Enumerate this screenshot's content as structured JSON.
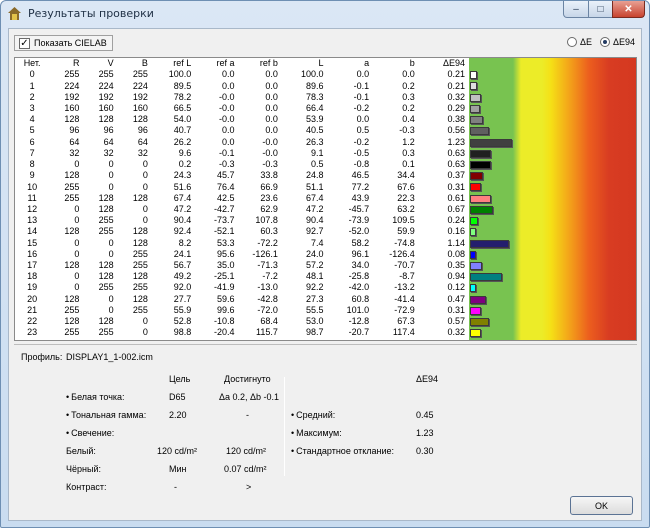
{
  "window": {
    "title": "Результаты проверки",
    "min_icon": "minimize-icon",
    "max_icon": "maximize-icon",
    "close_icon": "close-icon"
  },
  "options": {
    "show_cielab_label": "Показать CIELAB",
    "show_cielab_checked": true,
    "radio_de": "ΔE",
    "radio_de94": "ΔE94",
    "selected": "ΔE94"
  },
  "table": {
    "headers": [
      "Нет.",
      "R",
      "V",
      "B",
      "ref L",
      "ref a",
      "ref b",
      "L",
      "a",
      "b",
      "ΔE94"
    ],
    "rows": [
      {
        "n": "0",
        "r": "255",
        "g": "255",
        "b": "255",
        "refL": "100.0",
        "refa": "0.0",
        "refb": "0.0",
        "L": "100.0",
        "a": "0.0",
        "bb": "0.0",
        "de": "0.21",
        "color": "#ffffff"
      },
      {
        "n": "1",
        "r": "224",
        "g": "224",
        "b": "224",
        "refL": "89.5",
        "refa": "0.0",
        "refb": "0.0",
        "L": "89.6",
        "a": "-0.1",
        "bb": "0.2",
        "de": "0.21",
        "color": "#e0e0e0"
      },
      {
        "n": "2",
        "r": "192",
        "g": "192",
        "b": "192",
        "refL": "78.2",
        "refa": "-0.0",
        "refb": "0.0",
        "L": "78.3",
        "a": "-0.1",
        "bb": "0.3",
        "de": "0.32",
        "color": "#c0c0c0"
      },
      {
        "n": "3",
        "r": "160",
        "g": "160",
        "b": "160",
        "refL": "66.5",
        "refa": "-0.0",
        "refb": "0.0",
        "L": "66.4",
        "a": "-0.2",
        "bb": "0.2",
        "de": "0.29",
        "color": "#a0a0a0"
      },
      {
        "n": "4",
        "r": "128",
        "g": "128",
        "b": "128",
        "refL": "54.0",
        "refa": "-0.0",
        "refb": "0.0",
        "L": "53.9",
        "a": "0.0",
        "bb": "0.4",
        "de": "0.38",
        "color": "#808080"
      },
      {
        "n": "5",
        "r": "96",
        "g": "96",
        "b": "96",
        "refL": "40.7",
        "refa": "0.0",
        "refb": "0.0",
        "L": "40.5",
        "a": "0.5",
        "bb": "-0.3",
        "de": "0.56",
        "color": "#606060"
      },
      {
        "n": "6",
        "r": "64",
        "g": "64",
        "b": "64",
        "refL": "26.2",
        "refa": "0.0",
        "refb": "-0.0",
        "L": "26.3",
        "a": "-0.2",
        "bb": "1.2",
        "de": "1.23",
        "color": "#404040"
      },
      {
        "n": "7",
        "r": "32",
        "g": "32",
        "b": "32",
        "refL": "9.6",
        "refa": "-0.1",
        "refb": "-0.0",
        "L": "9.1",
        "a": "-0.5",
        "bb": "0.3",
        "de": "0.63",
        "color": "#202020"
      },
      {
        "n": "8",
        "r": "0",
        "g": "0",
        "b": "0",
        "refL": "0.2",
        "refa": "-0.3",
        "refb": "-0.3",
        "L": "0.5",
        "a": "-0.8",
        "bb": "0.1",
        "de": "0.63",
        "color": "#000000"
      },
      {
        "n": "9",
        "r": "128",
        "g": "0",
        "b": "0",
        "refL": "24.3",
        "refa": "45.7",
        "refb": "33.8",
        "L": "24.8",
        "a": "46.5",
        "bb": "34.4",
        "de": "0.37",
        "color": "#800000"
      },
      {
        "n": "10",
        "r": "255",
        "g": "0",
        "b": "0",
        "refL": "51.6",
        "refa": "76.4",
        "refb": "66.9",
        "L": "51.1",
        "a": "77.2",
        "bb": "67.6",
        "de": "0.31",
        "color": "#ff0000"
      },
      {
        "n": "11",
        "r": "255",
        "g": "128",
        "b": "128",
        "refL": "67.4",
        "refa": "42.5",
        "refb": "23.6",
        "L": "67.4",
        "a": "43.9",
        "bb": "22.3",
        "de": "0.61",
        "color": "#ff8080"
      },
      {
        "n": "12",
        "r": "0",
        "g": "128",
        "b": "0",
        "refL": "47.2",
        "refa": "-42.7",
        "refb": "62.9",
        "L": "47.2",
        "a": "-45.7",
        "bb": "63.2",
        "de": "0.67",
        "color": "#008000"
      },
      {
        "n": "13",
        "r": "0",
        "g": "255",
        "b": "0",
        "refL": "90.4",
        "refa": "-73.7",
        "refb": "107.8",
        "L": "90.4",
        "a": "-73.9",
        "bb": "109.5",
        "de": "0.24",
        "color": "#00ff00"
      },
      {
        "n": "14",
        "r": "128",
        "g": "255",
        "b": "128",
        "refL": "92.4",
        "refa": "-52.1",
        "refb": "60.3",
        "L": "92.7",
        "a": "-52.0",
        "bb": "59.9",
        "de": "0.16",
        "color": "#80ff80"
      },
      {
        "n": "15",
        "r": "0",
        "g": "0",
        "b": "128",
        "refL": "8.2",
        "refa": "53.3",
        "refb": "-72.2",
        "L": "7.4",
        "a": "58.2",
        "bb": "-74.8",
        "de": "1.14",
        "color": "#241e6e"
      },
      {
        "n": "16",
        "r": "0",
        "g": "0",
        "b": "255",
        "refL": "24.1",
        "refa": "95.6",
        "refb": "-126.1",
        "L": "24.0",
        "a": "96.1",
        "bb": "-126.4",
        "de": "0.08",
        "color": "#0000ff"
      },
      {
        "n": "17",
        "r": "128",
        "g": "128",
        "b": "255",
        "refL": "56.7",
        "refa": "35.0",
        "refb": "-71.3",
        "L": "57.2",
        "a": "34.0",
        "bb": "-70.7",
        "de": "0.35",
        "color": "#8080ff"
      },
      {
        "n": "18",
        "r": "0",
        "g": "128",
        "b": "128",
        "refL": "49.2",
        "refa": "-25.1",
        "refb": "-7.2",
        "L": "48.1",
        "a": "-25.8",
        "bb": "-8.7",
        "de": "0.94",
        "color": "#008080"
      },
      {
        "n": "19",
        "r": "0",
        "g": "255",
        "b": "255",
        "refL": "92.0",
        "refa": "-41.9",
        "refb": "-13.0",
        "L": "92.2",
        "a": "-42.0",
        "bb": "-13.2",
        "de": "0.12",
        "color": "#00ffff"
      },
      {
        "n": "20",
        "r": "128",
        "g": "0",
        "b": "128",
        "refL": "27.7",
        "refa": "59.6",
        "refb": "-42.8",
        "L": "27.3",
        "a": "60.8",
        "bb": "-41.4",
        "de": "0.47",
        "color": "#800080"
      },
      {
        "n": "21",
        "r": "255",
        "g": "0",
        "b": "255",
        "refL": "55.9",
        "refa": "99.6",
        "refb": "-72.0",
        "L": "55.5",
        "a": "101.0",
        "bb": "-72.9",
        "de": "0.31",
        "color": "#ff00ff"
      },
      {
        "n": "22",
        "r": "128",
        "g": "128",
        "b": "0",
        "refL": "52.8",
        "refa": "-10.8",
        "refb": "68.4",
        "L": "53.0",
        "a": "-12.8",
        "bb": "67.3",
        "de": "0.57",
        "color": "#808000"
      },
      {
        "n": "23",
        "r": "255",
        "g": "255",
        "b": "0",
        "refL": "98.8",
        "refa": "-20.4",
        "refb": "115.7",
        "L": "98.7",
        "a": "-20.7",
        "bb": "117.4",
        "de": "0.32",
        "color": "#ffff00"
      }
    ]
  },
  "summary": {
    "profile_label": "Профиль:",
    "profile_value": "DISPLAY1_1-002.icm",
    "col_target": "Цель",
    "col_achieved": "Достигнуто",
    "col_de94": "ΔE94",
    "white_point_label": "Белая точка:",
    "white_point_target": "D65",
    "white_point_achieved": "Δa 0.2, Δb -0.1",
    "tone_gamma_label": "Тональная гамма:",
    "tone_gamma_target": "2.20",
    "tone_gamma_achieved": "-",
    "luminance_label": "Свечение:",
    "white_label": "Белый:",
    "white_target": "120 cd/m²",
    "white_achieved": "120 cd/m²",
    "black_label": "Чёрный:",
    "black_target": "Мин",
    "black_achieved": "0.07 cd/m²",
    "contrast_label": "Контраст:",
    "contrast_target": "-",
    "contrast_achieved": ">",
    "avg_label": "Средний:",
    "avg_value": "0.45",
    "max_label": "Максимум:",
    "max_value": "1.23",
    "std_label": "Стандартное отклание:",
    "std_value": "0.30"
  },
  "ok_label": "OK"
}
